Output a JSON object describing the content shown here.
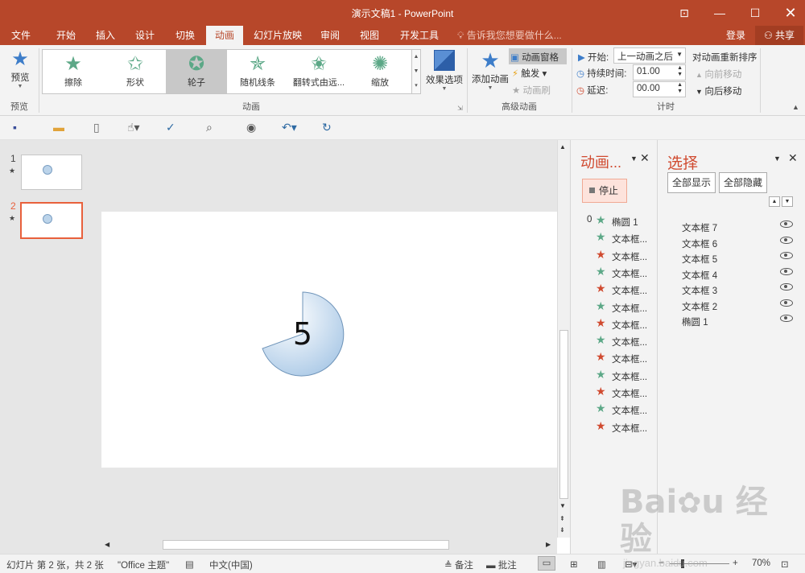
{
  "window": {
    "title": "演示文稿1 - PowerPoint"
  },
  "tabs": [
    "文件",
    "开始",
    "插入",
    "设计",
    "切换",
    "动画",
    "幻灯片放映",
    "审阅",
    "视图",
    "开发工具"
  ],
  "active_tab": "动画",
  "tell_me": "告诉我您想要做什么...",
  "account": {
    "login": "登录",
    "share": "共享"
  },
  "ribbon": {
    "preview": {
      "label": "预览",
      "group": "预览"
    },
    "gallery": [
      {
        "label": "擦除",
        "color": "#5ca887"
      },
      {
        "label": "形状",
        "color": "#5ca887"
      },
      {
        "label": "轮子",
        "color": "#5ca887"
      },
      {
        "label": "随机线条",
        "color": "#5ca887"
      },
      {
        "label": "翻转式由远...",
        "color": "#5ca887"
      },
      {
        "label": "缩放",
        "color": "#5ca887"
      }
    ],
    "selected_effect": "轮子",
    "effect_options": "效果选项",
    "animation_group": "动画",
    "add_animation": "添加动画",
    "animation_pane": "动画窗格",
    "trigger": "触发",
    "animation_painter": "动画刷",
    "advanced_group": "高级动画",
    "start_label": "开始:",
    "start_value": "上一动画之后",
    "duration_label": "持续时间:",
    "duration_value": "01.00",
    "delay_label": "延迟:",
    "delay_value": "00.00",
    "reorder_title": "对动画重新排序",
    "move_earlier": "向前移动",
    "move_later": "向后移动",
    "timing_group": "计时"
  },
  "slides": [
    {
      "number": "1",
      "star": "★"
    },
    {
      "number": "2",
      "star": "★"
    }
  ],
  "slide": {
    "content": "5"
  },
  "animation_pane": {
    "title": "动画...",
    "stop": "停止",
    "items": [
      {
        "num": "0",
        "icon": "star-green-icon",
        "color": "#5ca887",
        "label": "椭圆 1"
      },
      {
        "num": "",
        "icon": "star-green-icon",
        "color": "#5ca887",
        "label": "文本框..."
      },
      {
        "num": "",
        "icon": "star-red-icon",
        "color": "#d04a2f",
        "label": "文本框..."
      },
      {
        "num": "",
        "icon": "star-green-icon",
        "color": "#5ca887",
        "label": "文本框..."
      },
      {
        "num": "",
        "icon": "star-red-icon",
        "color": "#d04a2f",
        "label": "文本框..."
      },
      {
        "num": "",
        "icon": "star-green-icon",
        "color": "#5ca887",
        "label": "文本框..."
      },
      {
        "num": "",
        "icon": "star-red-icon",
        "color": "#d04a2f",
        "label": "文本框..."
      },
      {
        "num": "",
        "icon": "star-green-icon",
        "color": "#5ca887",
        "label": "文本框..."
      },
      {
        "num": "",
        "icon": "star-red-icon",
        "color": "#d04a2f",
        "label": "文本框..."
      },
      {
        "num": "",
        "icon": "star-green-icon",
        "color": "#5ca887",
        "label": "文本框..."
      },
      {
        "num": "",
        "icon": "star-red-icon",
        "color": "#d04a2f",
        "label": "文本框..."
      },
      {
        "num": "",
        "icon": "star-green-icon",
        "color": "#5ca887",
        "label": "文本框..."
      },
      {
        "num": "",
        "icon": "star-red-icon",
        "color": "#d04a2f",
        "label": "文本框..."
      }
    ]
  },
  "selection_pane": {
    "title": "选择",
    "show_all": "全部显示",
    "hide_all": "全部隐藏",
    "items": [
      "文本框 7",
      "文本框 6",
      "文本框 5",
      "文本框 4",
      "文本框 3",
      "文本框 2",
      "椭圆 1"
    ]
  },
  "status_bar": {
    "slide_info": "幻灯片 第 2 张，共 2 张",
    "theme": "\"Office 主题\"",
    "language": "中文(中国)",
    "notes": "备注",
    "comments": "批注",
    "zoom": "70%"
  },
  "watermark": "Baidu 经验 jingyan.baidu.com",
  "colors": {
    "accent": "#b7472a",
    "selected_thumb": "#e8603c"
  }
}
